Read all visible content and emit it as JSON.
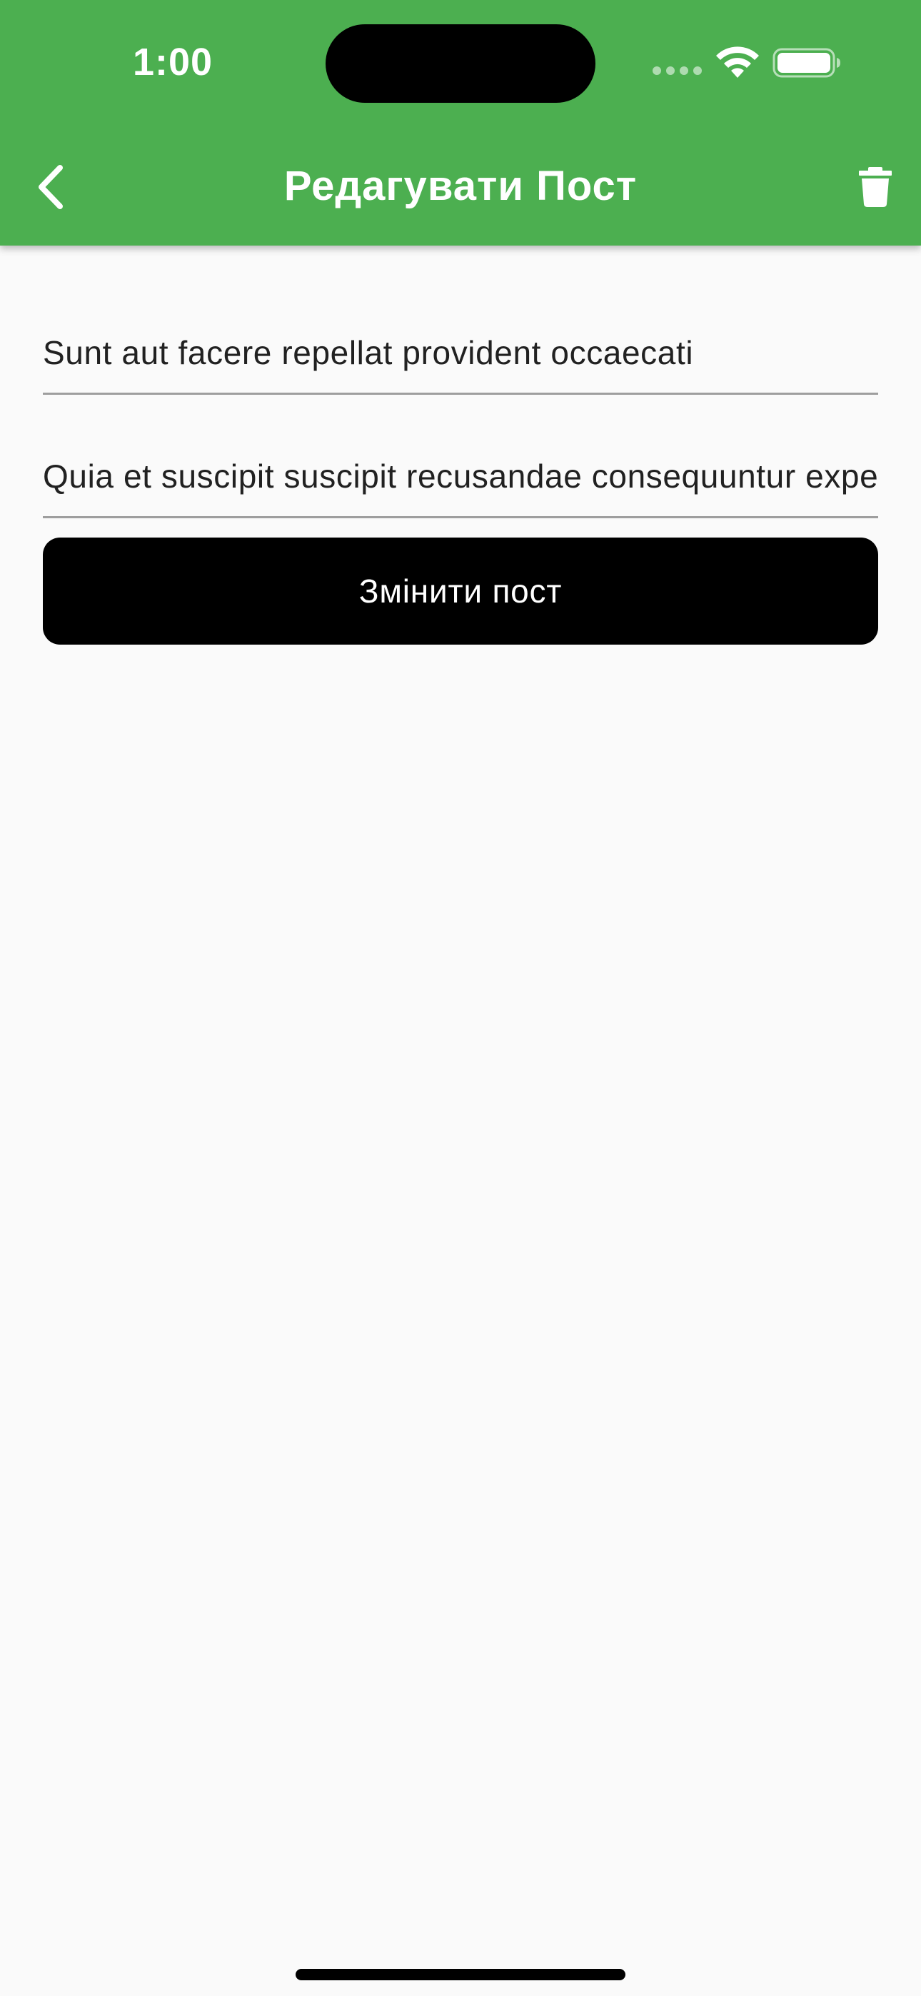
{
  "status_bar": {
    "time": "1:00",
    "wifi_icon": "wifi-icon",
    "battery_icon": "battery-full-icon"
  },
  "app_bar": {
    "title": "Редагувати Пост",
    "back_icon": "chevron-left-icon",
    "delete_icon": "trash-icon",
    "background_color": "#4caf50",
    "foreground_color": "#ffffff"
  },
  "form": {
    "title_field_value": "Sunt aut facere repellat provident occaecati",
    "body_field_value": "Quia et suscipit suscipit recusandae consequuntur expedita et cum",
    "submit_label": "Змінити пост",
    "submit_color": "#000000"
  }
}
